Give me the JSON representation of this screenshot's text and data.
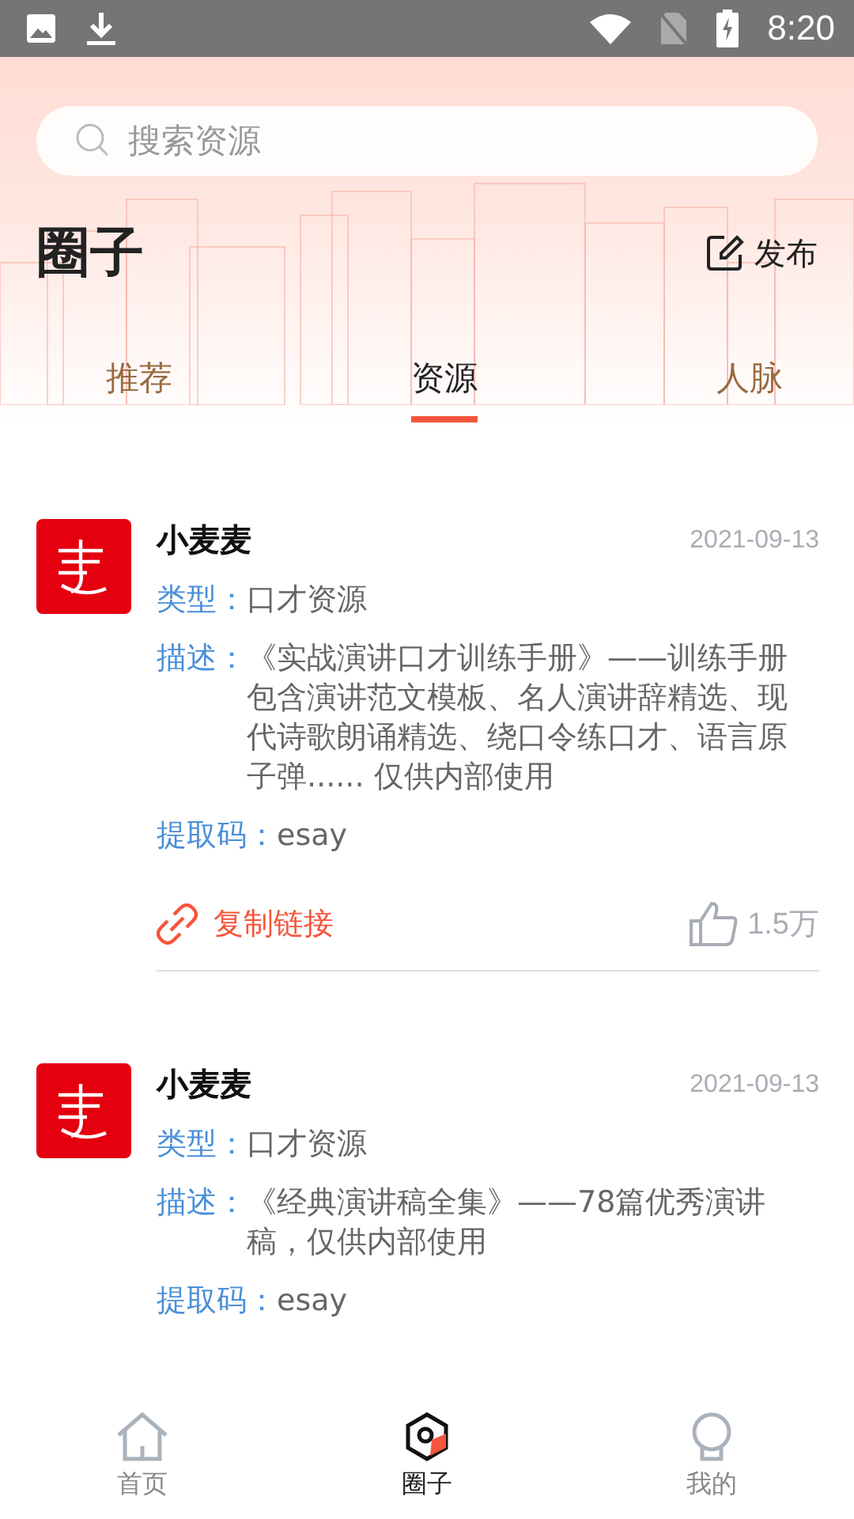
{
  "status_bar": {
    "time": "8:20"
  },
  "search": {
    "placeholder": "搜索资源"
  },
  "header": {
    "title": "圈子",
    "action": "发布"
  },
  "tabs": [
    {
      "label": "推荐",
      "selected": false
    },
    {
      "label": "资源",
      "selected": true
    },
    {
      "label": "人脉",
      "selected": false
    }
  ],
  "posts": [
    {
      "author": "小麦麦",
      "date": "2021-09-13",
      "fields": [
        {
          "label": "类型：",
          "value": "口才资源"
        },
        {
          "label": "描述：",
          "value": "《实战演讲口才训练手册》——训练手册包含演讲范文模板、名人演讲辞精选、现代诗歌朗诵精选、绕口令练口才、语言原子弹...... 仅供内部使用"
        },
        {
          "label": "提取码：",
          "value": "esay"
        }
      ],
      "copy_label": "复制链接",
      "likes": "1.5万"
    },
    {
      "author": "小麦麦",
      "date": "2021-09-13",
      "fields": [
        {
          "label": "类型：",
          "value": "口才资源"
        },
        {
          "label": "描述：",
          "value": "《经典演讲稿全集》——78篇优秀演讲稿，仅供内部使用"
        },
        {
          "label": "提取码：",
          "value": "esay"
        }
      ]
    }
  ],
  "bottom_nav": [
    {
      "label": "首页",
      "kind": "home",
      "selected": false
    },
    {
      "label": "圈子",
      "kind": "circle",
      "selected": true
    },
    {
      "label": "我的",
      "kind": "profile",
      "selected": false
    }
  ]
}
